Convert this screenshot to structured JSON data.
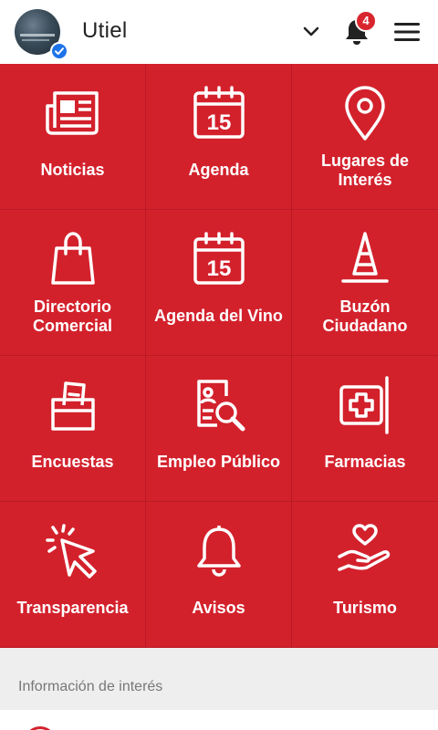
{
  "header": {
    "title": "Utiel",
    "notification_count": "4",
    "icons": {
      "avatar": "avatar-image",
      "verified": "verified-check-icon",
      "dropdown": "chevron-down-icon",
      "notifications": "bell-icon",
      "menu": "hamburger-menu-icon"
    }
  },
  "grid": {
    "accent_color": "#d3212c",
    "tiles": [
      {
        "label": "Noticias",
        "icon": "newspaper-icon"
      },
      {
        "label": "Agenda",
        "icon": "calendar-icon",
        "icon_text": "15"
      },
      {
        "label": "Lugares de Interés",
        "icon": "map-pin-icon"
      },
      {
        "label": "Directorio Comercial",
        "icon": "shopping-bag-icon"
      },
      {
        "label": "Agenda del Vino",
        "icon": "calendar-icon",
        "icon_text": "15"
      },
      {
        "label": "Buzón Ciudadano",
        "icon": "traffic-cone-icon"
      },
      {
        "label": "Encuestas",
        "icon": "ballot-box-icon"
      },
      {
        "label": "Empleo Público",
        "icon": "job-search-icon"
      },
      {
        "label": "Farmacias",
        "icon": "pharmacy-sign-icon"
      },
      {
        "label": "Transparencia",
        "icon": "click-cursor-icon"
      },
      {
        "label": "Avisos",
        "icon": "bell-icon"
      },
      {
        "label": "Turismo",
        "icon": "hand-heart-icon"
      }
    ]
  },
  "info": {
    "title": "Información de interés"
  }
}
